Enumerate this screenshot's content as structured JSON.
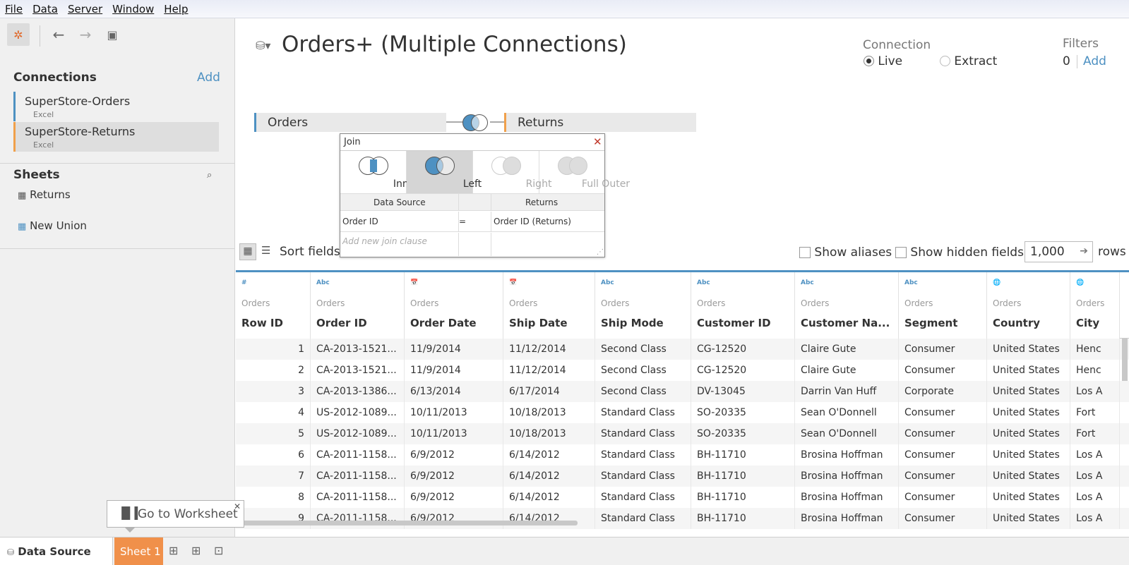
{
  "menu": [
    "File",
    "Data",
    "Server",
    "Window",
    "Help"
  ],
  "left": {
    "connections_title": "Connections",
    "add_label": "Add",
    "connections": [
      {
        "name": "SuperStore-Orders",
        "type": "Excel",
        "color": "#4e91c2"
      },
      {
        "name": "SuperStore-Returns",
        "type": "Excel",
        "color": "#f0a04b"
      }
    ],
    "sheets_title": "Sheets",
    "sheets": [
      "Returns",
      "New Union"
    ]
  },
  "canvas": {
    "title": "Orders+ (Multiple Connections)",
    "connection_label": "Connection",
    "live": "Live",
    "extract": "Extract",
    "filters_label": "Filters",
    "filters_count": "0",
    "filters_add": "Add",
    "left_table": "Orders",
    "right_table": "Returns"
  },
  "join": {
    "title": "Join",
    "types": [
      "Inner",
      "Left",
      "Right",
      "Full Outer"
    ],
    "col_left": "Data Source",
    "col_right": "Returns",
    "clause_left": "Order ID",
    "op": "=",
    "clause_right": "Order ID (Returns)",
    "add_clause": "Add new join clause"
  },
  "toolbar": {
    "sort_label": "Sort fields",
    "show_aliases": "Show aliases",
    "show_hidden": "Show hidden fields",
    "rows_value": "1,000",
    "rows_label": "rows"
  },
  "grid": {
    "columns": [
      {
        "icon": "#",
        "src": "Orders",
        "name": "Row ID"
      },
      {
        "icon": "Abc",
        "src": "Orders",
        "name": "Order ID"
      },
      {
        "icon": "📅",
        "src": "Orders",
        "name": "Order Date"
      },
      {
        "icon": "📅",
        "src": "Orders",
        "name": "Ship Date"
      },
      {
        "icon": "Abc",
        "src": "Orders",
        "name": "Ship Mode"
      },
      {
        "icon": "Abc",
        "src": "Orders",
        "name": "Customer ID"
      },
      {
        "icon": "Abc",
        "src": "Orders",
        "name": "Customer Na..."
      },
      {
        "icon": "Abc",
        "src": "Orders",
        "name": "Segment"
      },
      {
        "icon": "🌐",
        "src": "Orders",
        "name": "Country"
      },
      {
        "icon": "🌐",
        "src": "Orders",
        "name": "City"
      }
    ],
    "rows": [
      [
        "1",
        "CA-2013-1521...",
        "11/9/2014",
        "11/12/2014",
        "Second Class",
        "CG-12520",
        "Claire Gute",
        "Consumer",
        "United States",
        "Henc"
      ],
      [
        "2",
        "CA-2013-1521...",
        "11/9/2014",
        "11/12/2014",
        "Second Class",
        "CG-12520",
        "Claire Gute",
        "Consumer",
        "United States",
        "Henc"
      ],
      [
        "3",
        "CA-2013-1386...",
        "6/13/2014",
        "6/17/2014",
        "Second Class",
        "DV-13045",
        "Darrin Van Huff",
        "Corporate",
        "United States",
        "Los A"
      ],
      [
        "4",
        "US-2012-1089...",
        "10/11/2013",
        "10/18/2013",
        "Standard Class",
        "SO-20335",
        "Sean O'Donnell",
        "Consumer",
        "United States",
        "Fort"
      ],
      [
        "5",
        "US-2012-1089...",
        "10/11/2013",
        "10/18/2013",
        "Standard Class",
        "SO-20335",
        "Sean O'Donnell",
        "Consumer",
        "United States",
        "Fort"
      ],
      [
        "6",
        "CA-2011-1158...",
        "6/9/2012",
        "6/14/2012",
        "Standard Class",
        "BH-11710",
        "Brosina Hoffman",
        "Consumer",
        "United States",
        "Los A"
      ],
      [
        "7",
        "CA-2011-1158...",
        "6/9/2012",
        "6/14/2012",
        "Standard Class",
        "BH-11710",
        "Brosina Hoffman",
        "Consumer",
        "United States",
        "Los A"
      ],
      [
        "8",
        "CA-2011-1158...",
        "6/9/2012",
        "6/14/2012",
        "Standard Class",
        "BH-11710",
        "Brosina Hoffman",
        "Consumer",
        "United States",
        "Los A"
      ],
      [
        "9",
        "CA-2011-1158...",
        "6/9/2012",
        "6/14/2012",
        "Standard Class",
        "BH-11710",
        "Brosina Hoffman",
        "Consumer",
        "United States",
        "Los A"
      ]
    ]
  },
  "bottom": {
    "data_source": "Data Source",
    "sheet1": "Sheet 1",
    "goto": "Go to Worksheet"
  }
}
